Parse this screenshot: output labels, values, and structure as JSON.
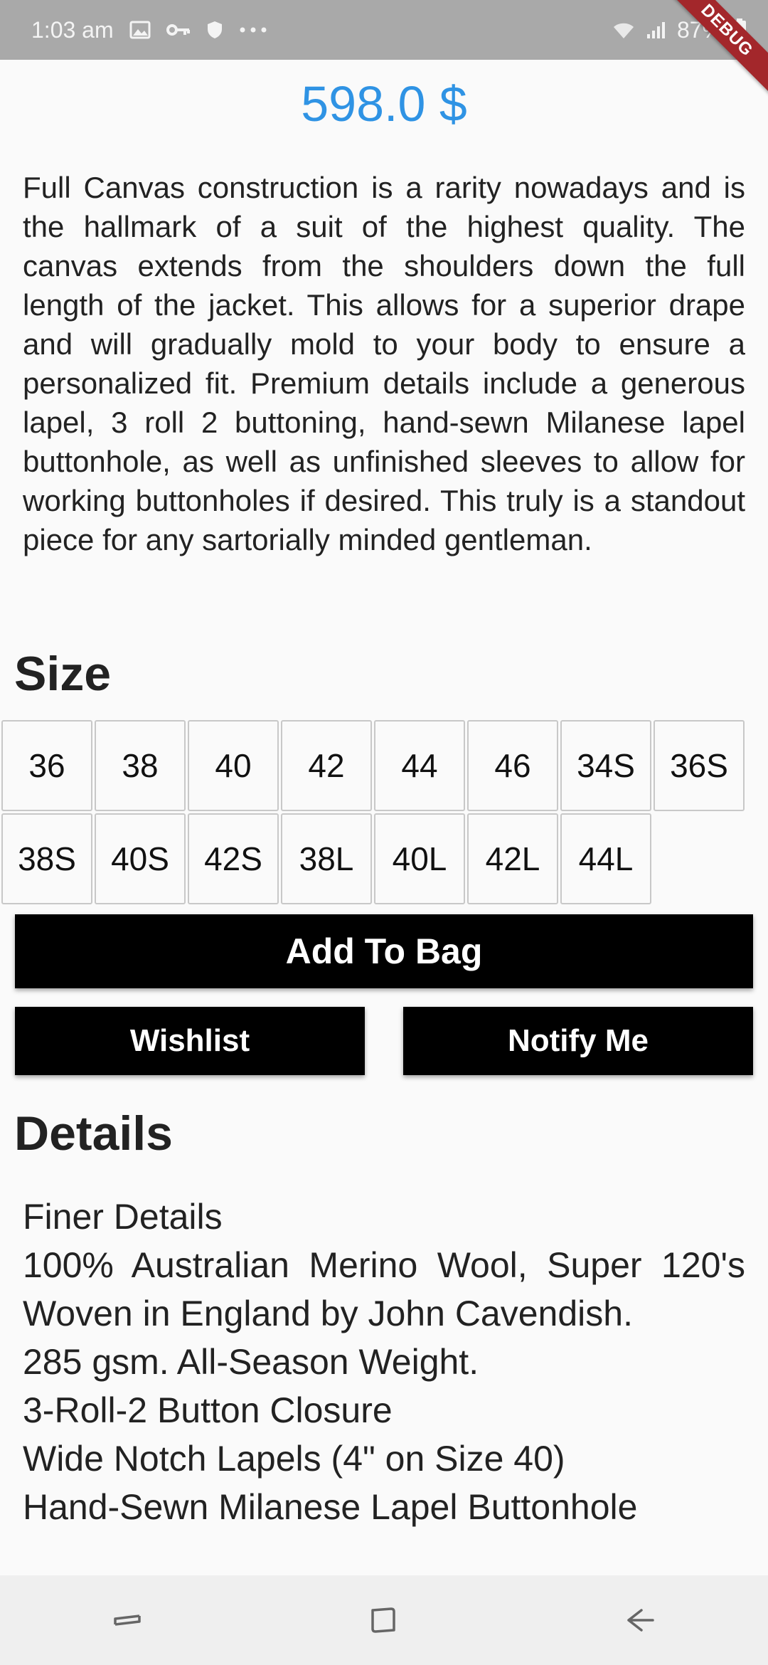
{
  "status_bar": {
    "time": "1:03 am",
    "battery": "87%",
    "icons": [
      "image-icon",
      "key-icon",
      "shield-icon",
      "more-dots-icon",
      "wifi-icon",
      "signal-icon",
      "battery-charging-icon"
    ]
  },
  "debug_banner": "DEBUG",
  "product": {
    "price": "598.0 $",
    "description": "Full Canvas construction is a rarity nowadays and is the hallmark of a suit of the highest quality. The canvas extends from the shoulders down the full length of the jacket. This allows for a superior drape and will gradually mold to your body to ensure a personalized fit. Premium details include a generous lapel, 3 roll 2 buttoning, hand-sewn Milanese lapel buttonhole, as well as unfinished sleeves to allow for working buttonholes if desired. This truly is a standout piece for any sartorially minded gentleman."
  },
  "size_section": {
    "title": "Size",
    "sizes": [
      "36",
      "38",
      "40",
      "42",
      "44",
      "46",
      "34S",
      "36S",
      "38S",
      "40S",
      "42S",
      "38L",
      "40L",
      "42L",
      "44L"
    ]
  },
  "actions": {
    "add_to_bag": "Add To Bag",
    "wishlist": "Wishlist",
    "notify_me": "Notify Me"
  },
  "details_section": {
    "title": "Details",
    "lines": [
      "Finer Details",
      "100% Australian Merino Wool, Super 120's Woven in England by John Cavendish.",
      "285 gsm. All-Season Weight.",
      "3-Roll-2 Button Closure",
      "Wide Notch Lapels (4\" on Size 40)",
      "Hand-Sewn Milanese Lapel Buttonhole"
    ]
  },
  "nav_bar": {
    "icons": [
      "recent-apps-icon",
      "home-icon",
      "back-icon"
    ]
  },
  "colors": {
    "price": "#2f93e4",
    "status_bar": "#a9a9a9",
    "buttons": "#000000",
    "debug_ribbon": "#a3272b"
  }
}
